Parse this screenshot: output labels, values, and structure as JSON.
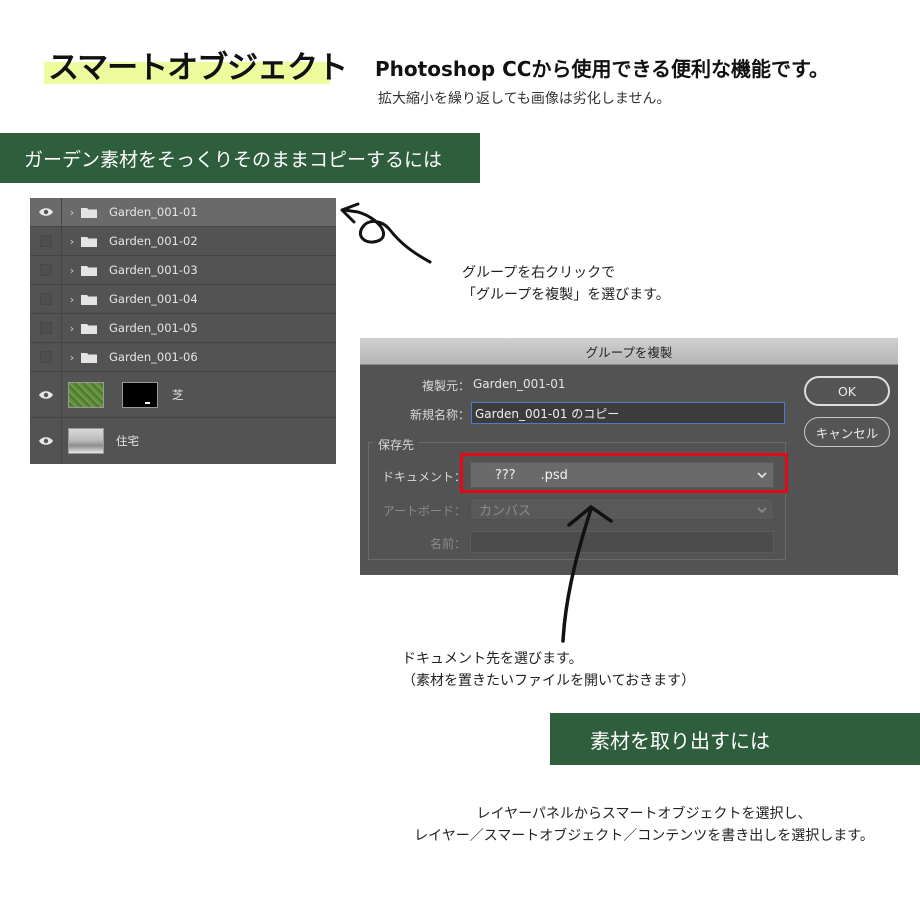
{
  "header": {
    "title": "スマートオブジェクト",
    "subtitle": "Photoshop CCから使用できる便利な機能です。",
    "note": "拡大縮小を繰り返しても画像は劣化しません。"
  },
  "section1": {
    "title": "ガーデン素材をそっくりそのままコピーするには"
  },
  "layers": {
    "groups": [
      {
        "name": "Garden_001-01",
        "visible": true,
        "selected": true
      },
      {
        "name": "Garden_001-02",
        "visible": false
      },
      {
        "name": "Garden_001-03",
        "visible": false
      },
      {
        "name": "Garden_001-04",
        "visible": false
      },
      {
        "name": "Garden_001-05",
        "visible": false
      },
      {
        "name": "Garden_001-06",
        "visible": false
      }
    ],
    "lawn_layer": {
      "name": "芝"
    },
    "house_layer": {
      "name": "住宅"
    }
  },
  "instruction1": {
    "line1": "グループを右クリックで",
    "line2": "「グループを複製」を選びます。"
  },
  "dialog": {
    "title": "グループを複製",
    "source_label": "複製元：",
    "source_value": "Garden_001-01",
    "newname_label": "新規名称：",
    "newname_value": "Garden_001-01 のコピー",
    "destination_label": "保存先",
    "document_label": "ドキュメント：",
    "document_value": "???      .psd",
    "artboard_label": "アートボード：",
    "artboard_value": "カンバス",
    "name_label": "名前：",
    "ok_label": "OK",
    "cancel_label": "キャンセル"
  },
  "instruction2": {
    "line1": "ドキュメント先を選びます。",
    "line2": "（素材を置きたいファイルを開いておきます）"
  },
  "section2": {
    "title": "素材を取り出すには"
  },
  "instruction3": {
    "line1": "レイヤーパネルからスマートオブジェクトを選択し、",
    "line2": "レイヤー／スマートオブジェクト／コンテンツを書き出しを選択します。"
  },
  "icons": {
    "eye": "eye-icon",
    "folder": "folder-icon",
    "chevron": "chevron-right-icon",
    "dropdown": "chevron-down-icon",
    "arrow": "hand-drawn-arrow"
  },
  "colors": {
    "banner_green": "#2e5e3c",
    "title_highlight": "#eefc9e",
    "panel_gray": "#535353",
    "highlight_red": "#e1081a"
  }
}
